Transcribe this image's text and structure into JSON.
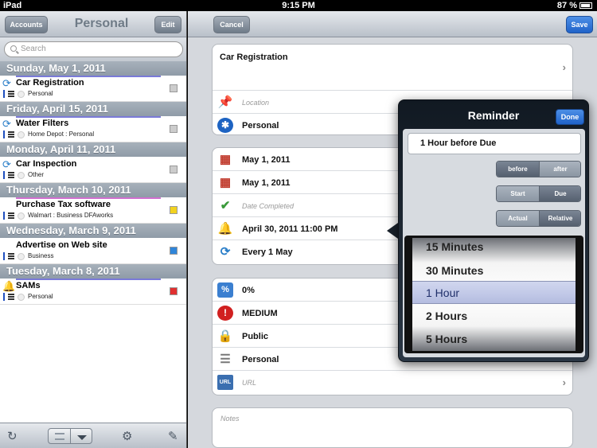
{
  "status": {
    "device": "iPad",
    "time": "9:15 PM",
    "battery": "87 %"
  },
  "left": {
    "back_label": "Accounts",
    "title": "Personal",
    "edit_label": "Edit",
    "search_placeholder": "Search",
    "sections": [
      {
        "header": "Sunday, May 1, 2011",
        "rows": [
          {
            "title": "Car Registration",
            "sub": "Personal",
            "icon": "repeat-icon",
            "underline": "#7a7ad8",
            "checkbox": "#cccccc"
          }
        ]
      },
      {
        "header": "Friday, April 15, 2011",
        "rows": [
          {
            "title": "Water Filters",
            "sub": "Home Depot : Personal",
            "icon": "repeat-icon",
            "underline": "#7a7ad8",
            "checkbox": "#cccccc"
          }
        ]
      },
      {
        "header": "Monday, April 11, 2011",
        "rows": [
          {
            "title": "Car Inspection",
            "sub": "Other",
            "icon": "repeat-icon",
            "underline": "",
            "checkbox": "#cccccc"
          }
        ]
      },
      {
        "header": "Thursday, March 10, 2011",
        "rows": [
          {
            "title": "Purchase Tax software",
            "sub": "Walmart : Business DFAworks",
            "icon": "",
            "underline": "#d070d0",
            "checkbox": "#f2d21f"
          }
        ]
      },
      {
        "header": "Wednesday, March 9, 2011",
        "rows": [
          {
            "title": "Advertise on Web site",
            "sub": "Business",
            "icon": "",
            "underline": "",
            "checkbox": "#2f85d9"
          }
        ]
      },
      {
        "header": "Tuesday, March 8, 2011",
        "rows": [
          {
            "title": "SAMs",
            "sub": "Personal",
            "icon": "bell-icon",
            "underline": "#7a7ad8",
            "checkbox": "#e03030"
          }
        ]
      }
    ]
  },
  "right": {
    "cancel_label": "Cancel",
    "save_label": "Save",
    "group1": {
      "title": "Car Registration",
      "location_placeholder": "Location",
      "context": "Personal"
    },
    "group2": {
      "start": "May 1, 2011",
      "due": "May 1, 2011",
      "completed_placeholder": "Date Completed",
      "reminder": "April 30, 2011 11:00 PM",
      "repeat": "Every 1 May"
    },
    "group3": {
      "progress": "0%",
      "priority": "MEDIUM",
      "privacy": "Public",
      "category": "Personal",
      "url_placeholder": "URL"
    },
    "notes_placeholder": "Notes"
  },
  "popover": {
    "title": "Reminder",
    "done_label": "Done",
    "value": "1 Hour before Due",
    "seg1": {
      "a": "before",
      "b": "after"
    },
    "seg2": {
      "a": "Start",
      "b": "Due"
    },
    "seg3": {
      "a": "Actual",
      "b": "Relative"
    },
    "options": [
      "15 Minutes",
      "30 Minutes",
      "1 Hour",
      "2 Hours",
      "5 Hours"
    ],
    "selected_index": 2
  }
}
